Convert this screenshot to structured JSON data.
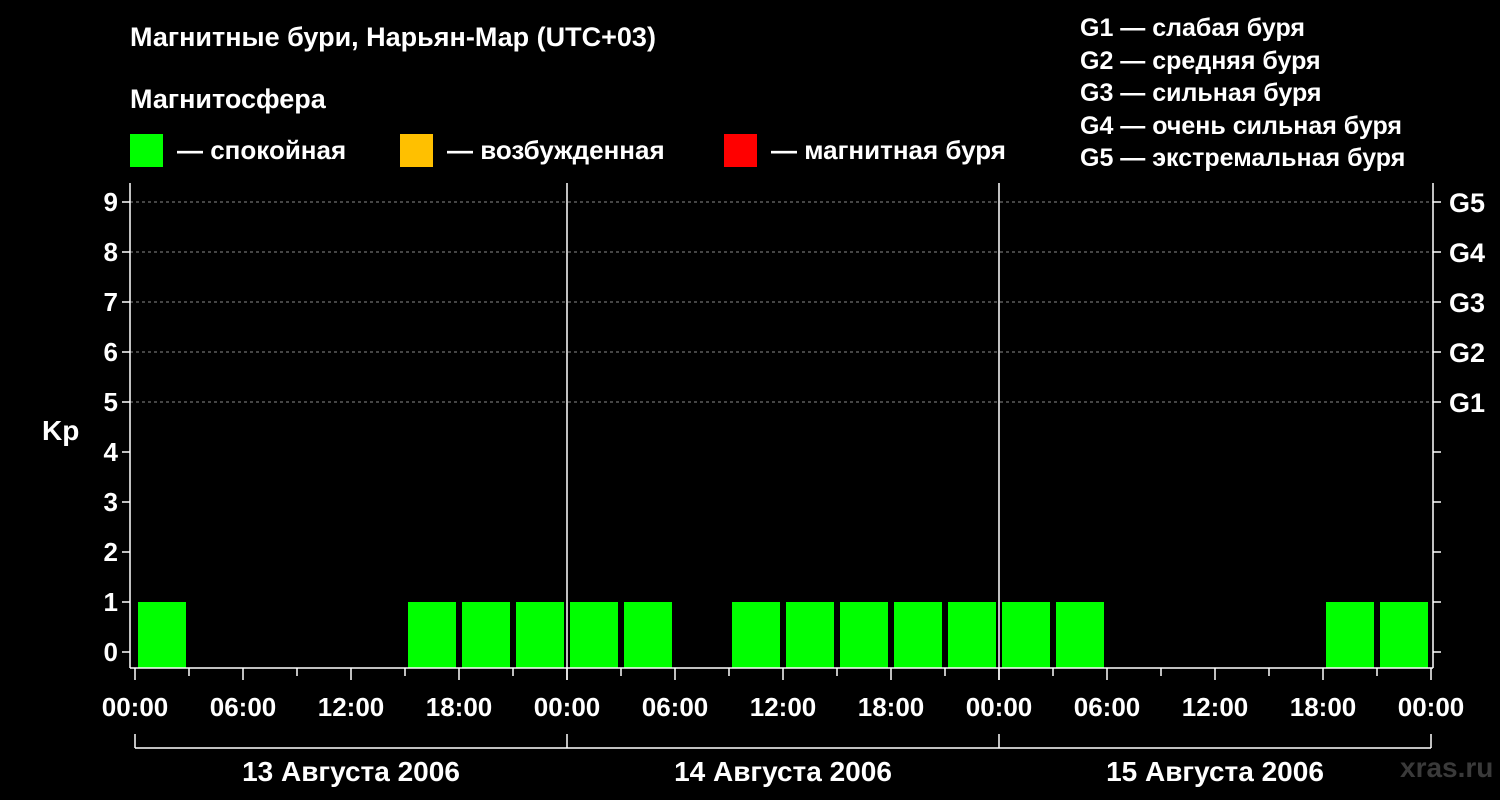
{
  "header": {
    "title": "Магнитные бури, Нарьян-Мар (UTC+03)",
    "subtitle": "Магнитосфера"
  },
  "legend": [
    {
      "label": "— спокойная",
      "color": "#00ff00"
    },
    {
      "label": "— возбужденная",
      "color": "#ffc000"
    },
    {
      "label": "— магнитная буря",
      "color": "#ff0000"
    }
  ],
  "storm_levels": [
    "G1 — слабая буря",
    "G2 — средняя буря",
    "G3 — сильная буря",
    "G4 — очень сильная буря",
    "G5 — экстремальная буря"
  ],
  "watermark": "xras.ru",
  "chart_data": {
    "type": "bar",
    "ylabel": "Kp",
    "ylim": [
      0,
      9
    ],
    "yticks": [
      "0",
      "1",
      "2",
      "3",
      "4",
      "5",
      "6",
      "7",
      "8",
      "9"
    ],
    "right_axis_labels": [
      {
        "kp": 5,
        "label": "G1"
      },
      {
        "kp": 6,
        "label": "G2"
      },
      {
        "kp": 7,
        "label": "G3"
      },
      {
        "kp": 8,
        "label": "G4"
      },
      {
        "kp": 9,
        "label": "G5"
      }
    ],
    "xtick_labels": [
      "00:00",
      "06:00",
      "12:00",
      "18:00",
      "00:00",
      "06:00",
      "12:00",
      "18:00",
      "00:00",
      "06:00",
      "12:00",
      "18:00",
      "00:00"
    ],
    "days": [
      "13 Августа 2006",
      "14 Августа 2006",
      "15 Августа 2006"
    ],
    "grid": true,
    "interval_hours": 3,
    "series": [
      {
        "values": [
          1,
          0,
          0,
          0,
          0,
          1,
          1,
          1,
          1,
          1,
          0,
          1,
          1,
          1,
          1,
          1,
          1,
          1,
          0,
          0,
          0,
          0,
          1,
          1
        ]
      }
    ]
  }
}
